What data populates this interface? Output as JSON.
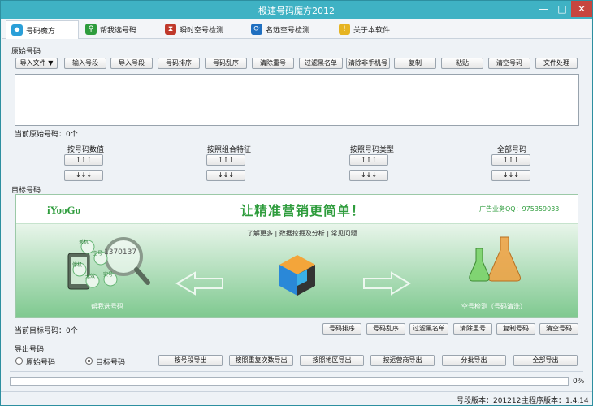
{
  "title": "极速号码魔方2012",
  "titlebar": {
    "min": "—",
    "max": "□",
    "close": "✕"
  },
  "tabs": [
    {
      "label": "号码魔方",
      "icon": "cube-icon",
      "color": "#2a9fd8"
    },
    {
      "label": "帮我选号码",
      "icon": "magnifier-icon",
      "color": "#2e9c3c"
    },
    {
      "label": "瞬时空号检测",
      "icon": "hourglass-icon",
      "color": "#c0392b"
    },
    {
      "label": "名远空号检测",
      "icon": "refresh-icon",
      "color": "#1f6fc0"
    },
    {
      "label": "关于本软件",
      "icon": "info-icon",
      "color": "#e6b422"
    }
  ],
  "source": {
    "label": "原始号码",
    "buttons": [
      "导入文件",
      "输入号段",
      "导入号段",
      "号码排序",
      "号码乱序",
      "清除重号",
      "过滤黑名单",
      "清除非手机号",
      "复制",
      "粘贴",
      "清空号码",
      "文件处理"
    ],
    "import_arrow": "▼",
    "count_text": "当前原始号码：0个"
  },
  "filters": [
    {
      "label": "按号码数值",
      "up": "↑↑↑",
      "down": "↓↓↓"
    },
    {
      "label": "按照组合特征",
      "up": "↑↑↑",
      "down": "↓↓↓"
    },
    {
      "label": "按照号码类型",
      "up": "↑↑↑",
      "down": "↓↓↓"
    },
    {
      "label": "全部号码",
      "up": "↑↑↑",
      "down": "↓↓↓"
    }
  ],
  "target": {
    "label": "目标号码",
    "count_text": "当前目标号码：0个",
    "buttons": [
      "号码排序",
      "号码乱序",
      "过滤黑名单",
      "清除重号",
      "复制号码",
      "清空号码"
    ]
  },
  "banner": {
    "logo": "iYooGo",
    "slogan": "让精准营销更简单！",
    "ad": "广告业务QQ：975359033",
    "links": "了解更多 | 数据挖掘及分析 | 常见问题",
    "number_sample": "1370137",
    "bubbles": [
      "关机",
      "空号",
      "停机",
      "无效",
      "实号",
      "停号"
    ],
    "left_caption": "帮我选号码",
    "right_caption": "空号检测（号码清洗）"
  },
  "export": {
    "label": "导出号码",
    "radios": [
      {
        "label": "原始号码",
        "checked": false
      },
      {
        "label": "目标号码",
        "checked": true
      }
    ],
    "buttons": [
      "按号段导出",
      "按照重复次数导出",
      "按照地区导出",
      "按运营商导出",
      "分批导出",
      "全部导出"
    ]
  },
  "progress": {
    "value": 0,
    "text": "0%"
  },
  "status": {
    "segment_version": "号段版本：201212",
    "app_version": "主程序版本：1.4.14"
  },
  "colors": {
    "titlebar": "#3fb2c4",
    "banner_green": "#2e9c3c"
  }
}
